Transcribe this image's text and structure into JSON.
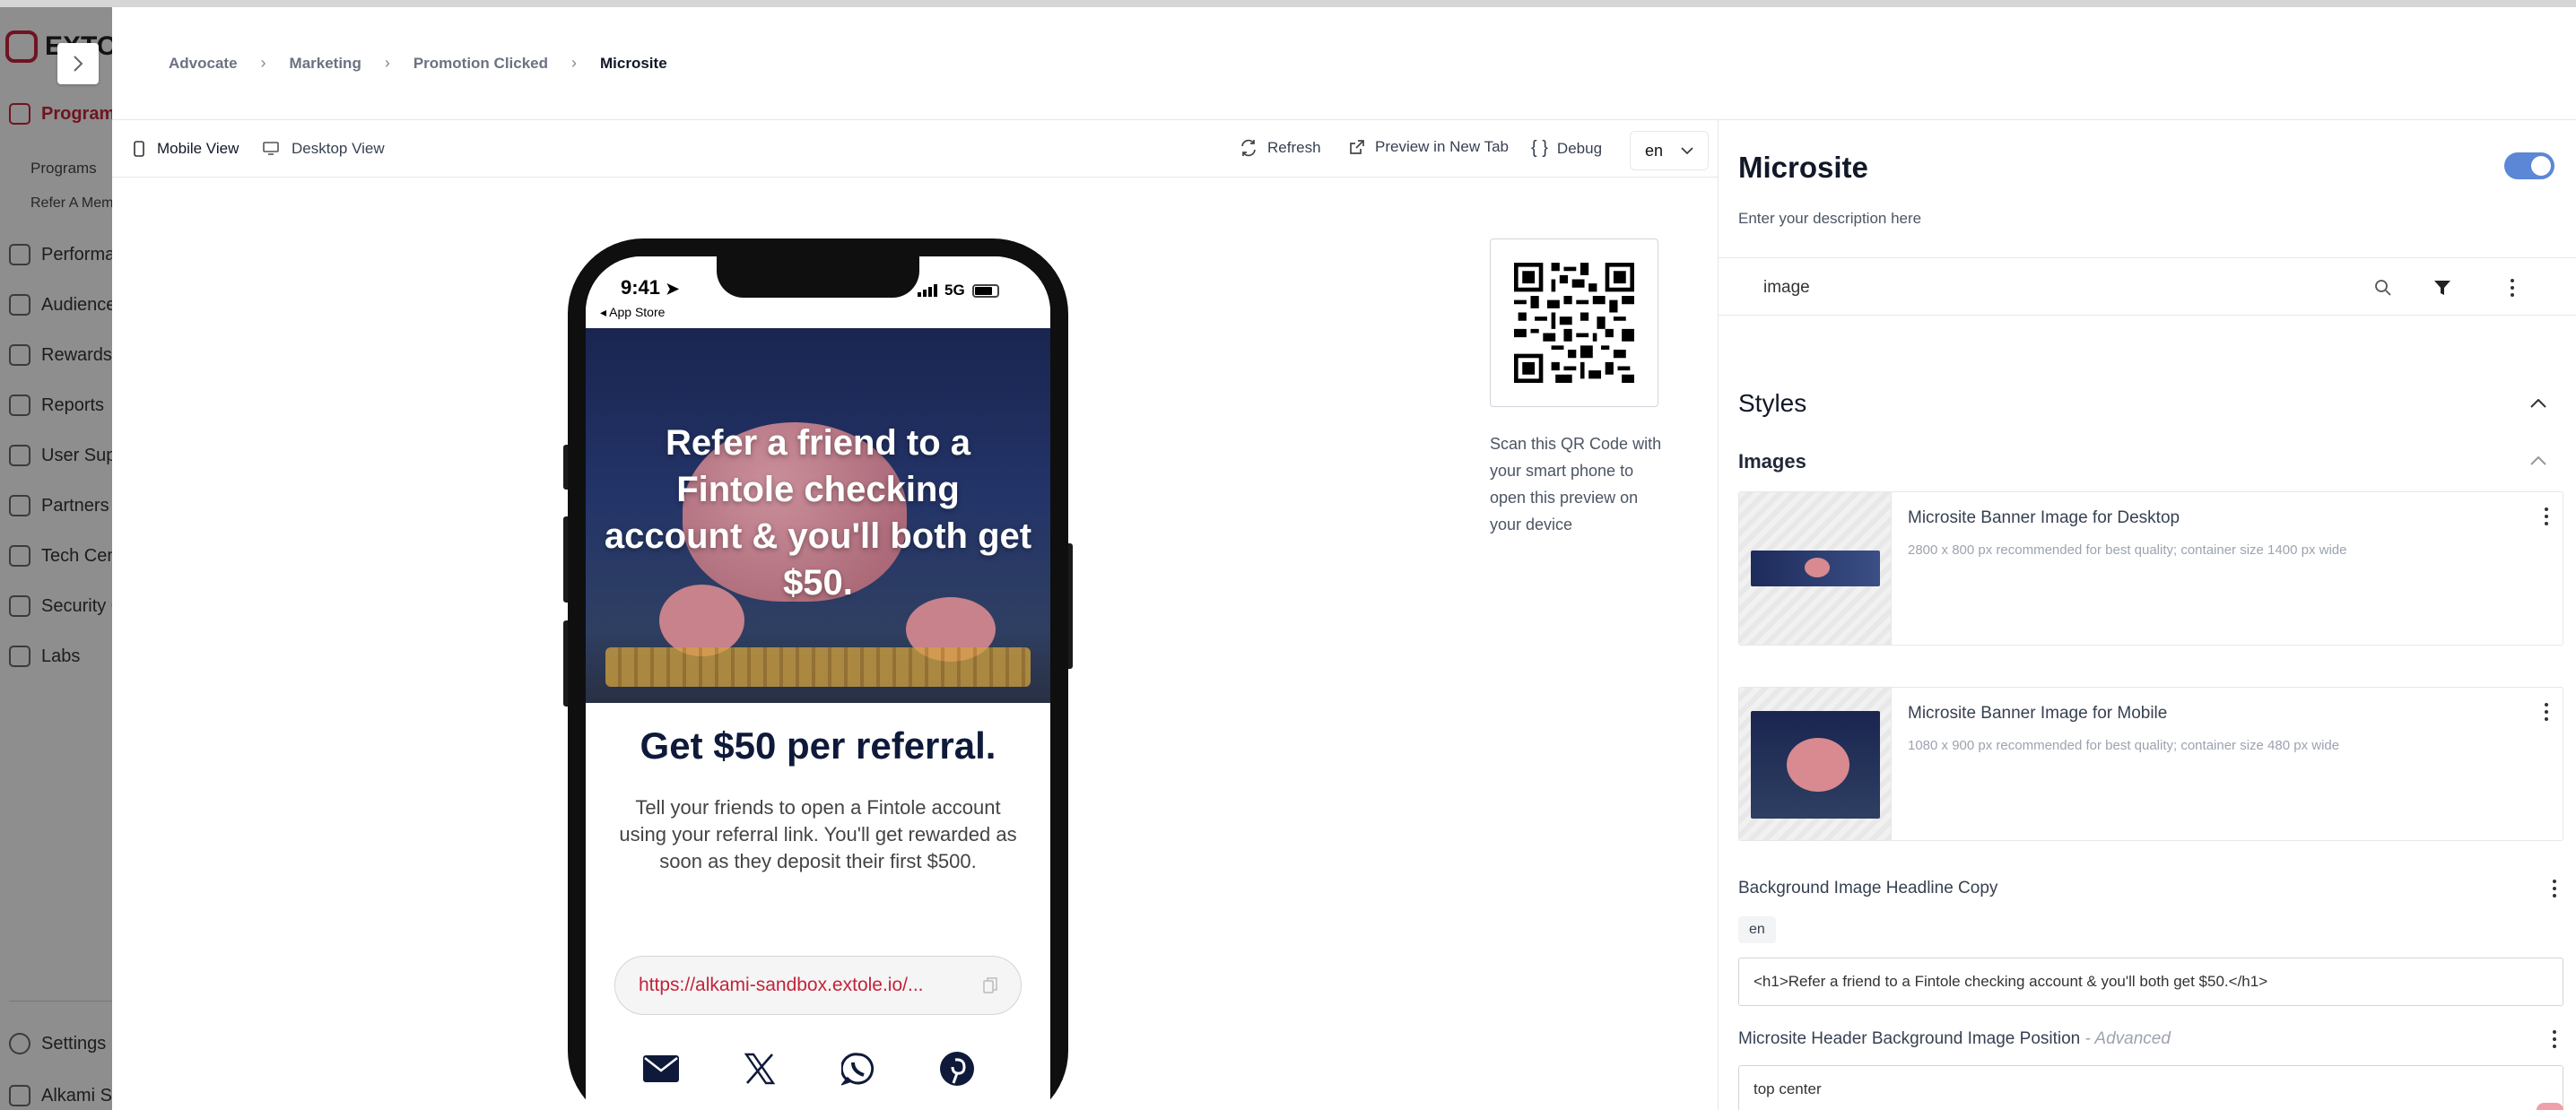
{
  "app": {
    "brand": "EXTOLE",
    "sidebar": [
      {
        "label": "Programs",
        "active": true
      },
      {
        "label": "Performance"
      },
      {
        "label": "Audiences"
      },
      {
        "label": "Rewards"
      },
      {
        "label": "Reports"
      },
      {
        "label": "User Support"
      },
      {
        "label": "Partners"
      },
      {
        "label": "Tech Center"
      },
      {
        "label": "Security Center"
      },
      {
        "label": "Labs"
      }
    ],
    "sidebar_sub": [
      "Programs",
      "Refer A Member"
    ],
    "settings": "Settings",
    "account": "Alkami Sandbox"
  },
  "breadcrumb": {
    "items": [
      "Advocate",
      "Marketing",
      "Promotion Clicked"
    ],
    "current": "Microsite"
  },
  "toolbar": {
    "mobile_view": "Mobile View",
    "desktop_view": "Desktop View",
    "refresh": "Refresh",
    "preview_new_tab": "Preview in New Tab",
    "debug": "Debug",
    "language": "en"
  },
  "phone": {
    "time": "9:41",
    "back_app": "◂ App Store",
    "network": "5G",
    "hero_headline": "Refer a friend to a Fintole checking account & you'll both get $50.",
    "headline": "Get $50 per referral.",
    "body": "Tell your friends to open a Fintole account using your referral link. You'll get rewarded as soon as they deposit their first $500.",
    "referral_link": "https://alkami-sandbox.extole.io/...",
    "share_icons": [
      "email-icon",
      "x-icon",
      "whatsapp-icon",
      "pinterest-icon"
    ]
  },
  "qr": {
    "caption": "Scan this QR Code with your smart phone to open this preview on your device"
  },
  "settings_panel": {
    "title": "Microsite",
    "description": "Enter your description here",
    "enabled": true,
    "search_value": "image",
    "styles_heading": "Styles",
    "images_heading": "Images",
    "image_cards": [
      {
        "title": "Microsite Banner Image for Desktop",
        "hint": "2800 x 800 px recommended for best quality; container size 1400 px wide"
      },
      {
        "title": "Microsite Banner Image for Mobile",
        "hint": "1080 x 900 px recommended for best quality; container size 480 px wide"
      }
    ],
    "headline_copy_label": "Background Image Headline Copy",
    "headline_copy_lang": "en",
    "headline_copy_value": "<h1>Refer a friend to a Fintole checking account & you'll both get $50.</h1>",
    "bg_position_label": "Microsite Header Background Image Position",
    "bg_position_advanced": "- Advanced",
    "bg_position_value": "top center"
  },
  "colors": {
    "brand_red": "#c2233a",
    "toggle_blue": "#5b87d6",
    "hero_navy": "#1a2550"
  }
}
